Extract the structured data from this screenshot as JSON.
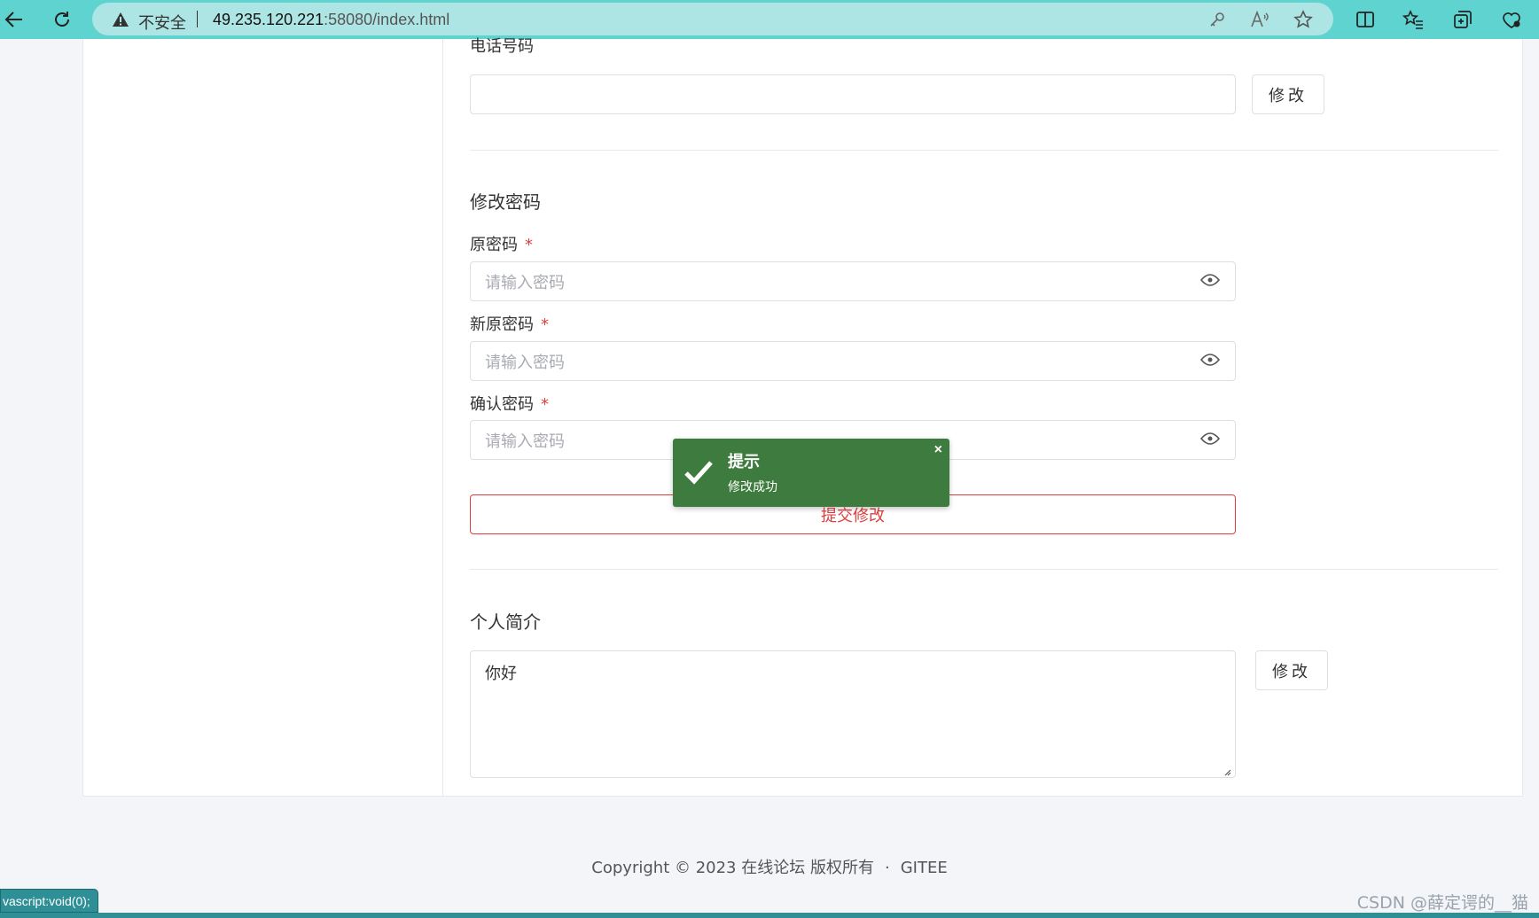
{
  "browser": {
    "security_label": "不安全",
    "url_host": "49.235.120.221",
    "url_rest": ":58080/index.html",
    "icons": [
      "back-icon",
      "refresh-icon",
      "warning-icon",
      "key-icon",
      "read-aloud-icon",
      "star-icon",
      "split-screen-icon",
      "favorites-icon",
      "collections-icon",
      "extensions-icon"
    ]
  },
  "phone": {
    "label": "电话号码",
    "value": "",
    "edit_button": "修改"
  },
  "password": {
    "section_title": "修改密码",
    "old_label": "原密码",
    "new_label": "新原密码",
    "confirm_label": "确认密码",
    "required_mark": "*",
    "placeholder": "请输入密码",
    "submit_label": "提交修改"
  },
  "bio": {
    "section_title": "个人简介",
    "value": "你好",
    "edit_button": "修改"
  },
  "toast": {
    "title": "提示",
    "message": "修改成功",
    "close": "×",
    "color": "#3e7b3e"
  },
  "footer": {
    "copyright": "Copyright © 2023 在线论坛 版权所有",
    "separator": "·",
    "link": "GITEE"
  },
  "status_bar": {
    "link_preview": "vascript:void(0);"
  },
  "watermark": "CSDN @薛定谔的__猫",
  "colors": {
    "accent_red": "#e03e3e",
    "browser_bar": "#5fd3d0",
    "toast_green": "#3e7b3e"
  }
}
